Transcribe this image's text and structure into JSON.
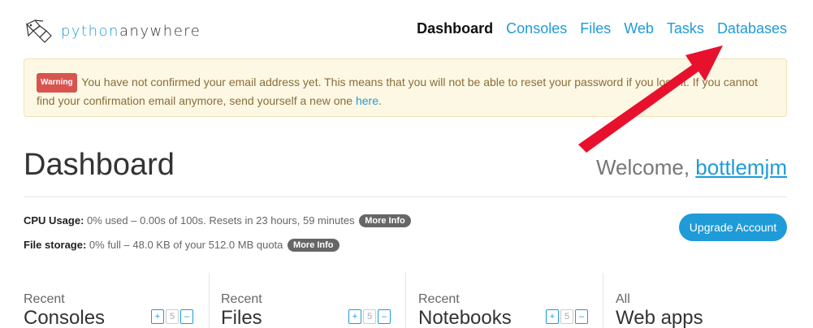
{
  "logo": {
    "python": "python",
    "anywhere": "anywhere"
  },
  "nav": [
    {
      "label": "Dashboard",
      "active": true
    },
    {
      "label": "Consoles"
    },
    {
      "label": "Files"
    },
    {
      "label": "Web"
    },
    {
      "label": "Tasks"
    },
    {
      "label": "Databases"
    }
  ],
  "warning": {
    "badge": "Warning",
    "text": "You have not confirmed your email address yet. This means that you will not be able to reset your password if you lose it. If you cannot find your confirmation email anymore, send yourself a new one",
    "link": "here",
    "end": "."
  },
  "page": {
    "title": "Dashboard",
    "welcome_prefix": "Welcome, ",
    "username": "bottlemjm"
  },
  "usage": {
    "cpu_label": "CPU Usage:",
    "cpu_value": "0% used – 0.00s of 100s. Resets in 23 hours, 59 minutes",
    "storage_label": "File storage:",
    "storage_value": "0% full – 48.0 KB of your 512.0 MB quota",
    "more_info": "More Info"
  },
  "upgrade_label": "Upgrade Account",
  "panels": [
    {
      "small": "Recent",
      "big": "Consoles",
      "count": "5"
    },
    {
      "small": "Recent",
      "big": "Files",
      "count": "5"
    },
    {
      "small": "Recent",
      "big": "Notebooks",
      "count": "5"
    },
    {
      "small": "All",
      "big": "Web apps"
    }
  ],
  "stepper": {
    "plus": "+",
    "minus": "–"
  },
  "colors": {
    "accent": "#1f9bd8",
    "arrow": "#e8112d",
    "warning_bg": "#fcf8e3"
  }
}
